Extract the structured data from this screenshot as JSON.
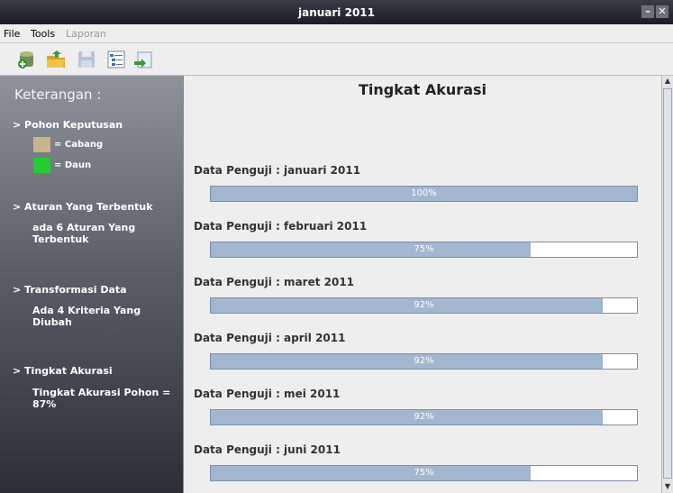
{
  "window": {
    "title": "januari 2011",
    "minimize": "–",
    "close": "✕"
  },
  "menu": {
    "file": "File",
    "tools": "Tools",
    "laporan": "Laporan"
  },
  "toolbar": {
    "buttons": [
      {
        "icon": "new-database-icon"
      },
      {
        "icon": "open-folder-icon"
      },
      {
        "icon": "save-disk-icon"
      },
      {
        "icon": "tree-list-icon"
      },
      {
        "icon": "export-icon"
      }
    ]
  },
  "sidebar": {
    "heading": "Keterangan :",
    "pohon_header": "> Pohon Keputusan",
    "legend_cabang": "= Cabang",
    "legend_daun": "= Daun",
    "cabang_color": "#c8b48c",
    "daun_color": "#22cc33",
    "aturan_header": "> Aturan Yang Terbentuk",
    "aturan_text": "ada 6 Aturan Yang Terbentuk",
    "transformasi_header": "> Transformasi Data",
    "transformasi_text": "Ada 4 Kriteria Yang Diubah",
    "akurasi_header": "> Tingkat Akurasi",
    "akurasi_text": "Tingkat Akurasi Pohon = 87%"
  },
  "main": {
    "title": "Tingkat Akurasi",
    "rows": [
      {
        "label": "Data Penguji : januari 2011",
        "percent_text": "100%",
        "fill": 1.0
      },
      {
        "label": "Data Penguji : februari 2011",
        "percent_text": "75%",
        "fill": 0.75
      },
      {
        "label": "Data Penguji : maret 2011",
        "percent_text": "92%",
        "fill": 0.92
      },
      {
        "label": "Data Penguji : april 2011",
        "percent_text": "92%",
        "fill": 0.92
      },
      {
        "label": "Data Penguji : mei 2011",
        "percent_text": "92%",
        "fill": 0.92
      },
      {
        "label": "Data Penguji : juni 2011",
        "percent_text": "75%",
        "fill": 0.75
      }
    ]
  },
  "scrollbar": {
    "up": "▲",
    "down": "▼"
  }
}
